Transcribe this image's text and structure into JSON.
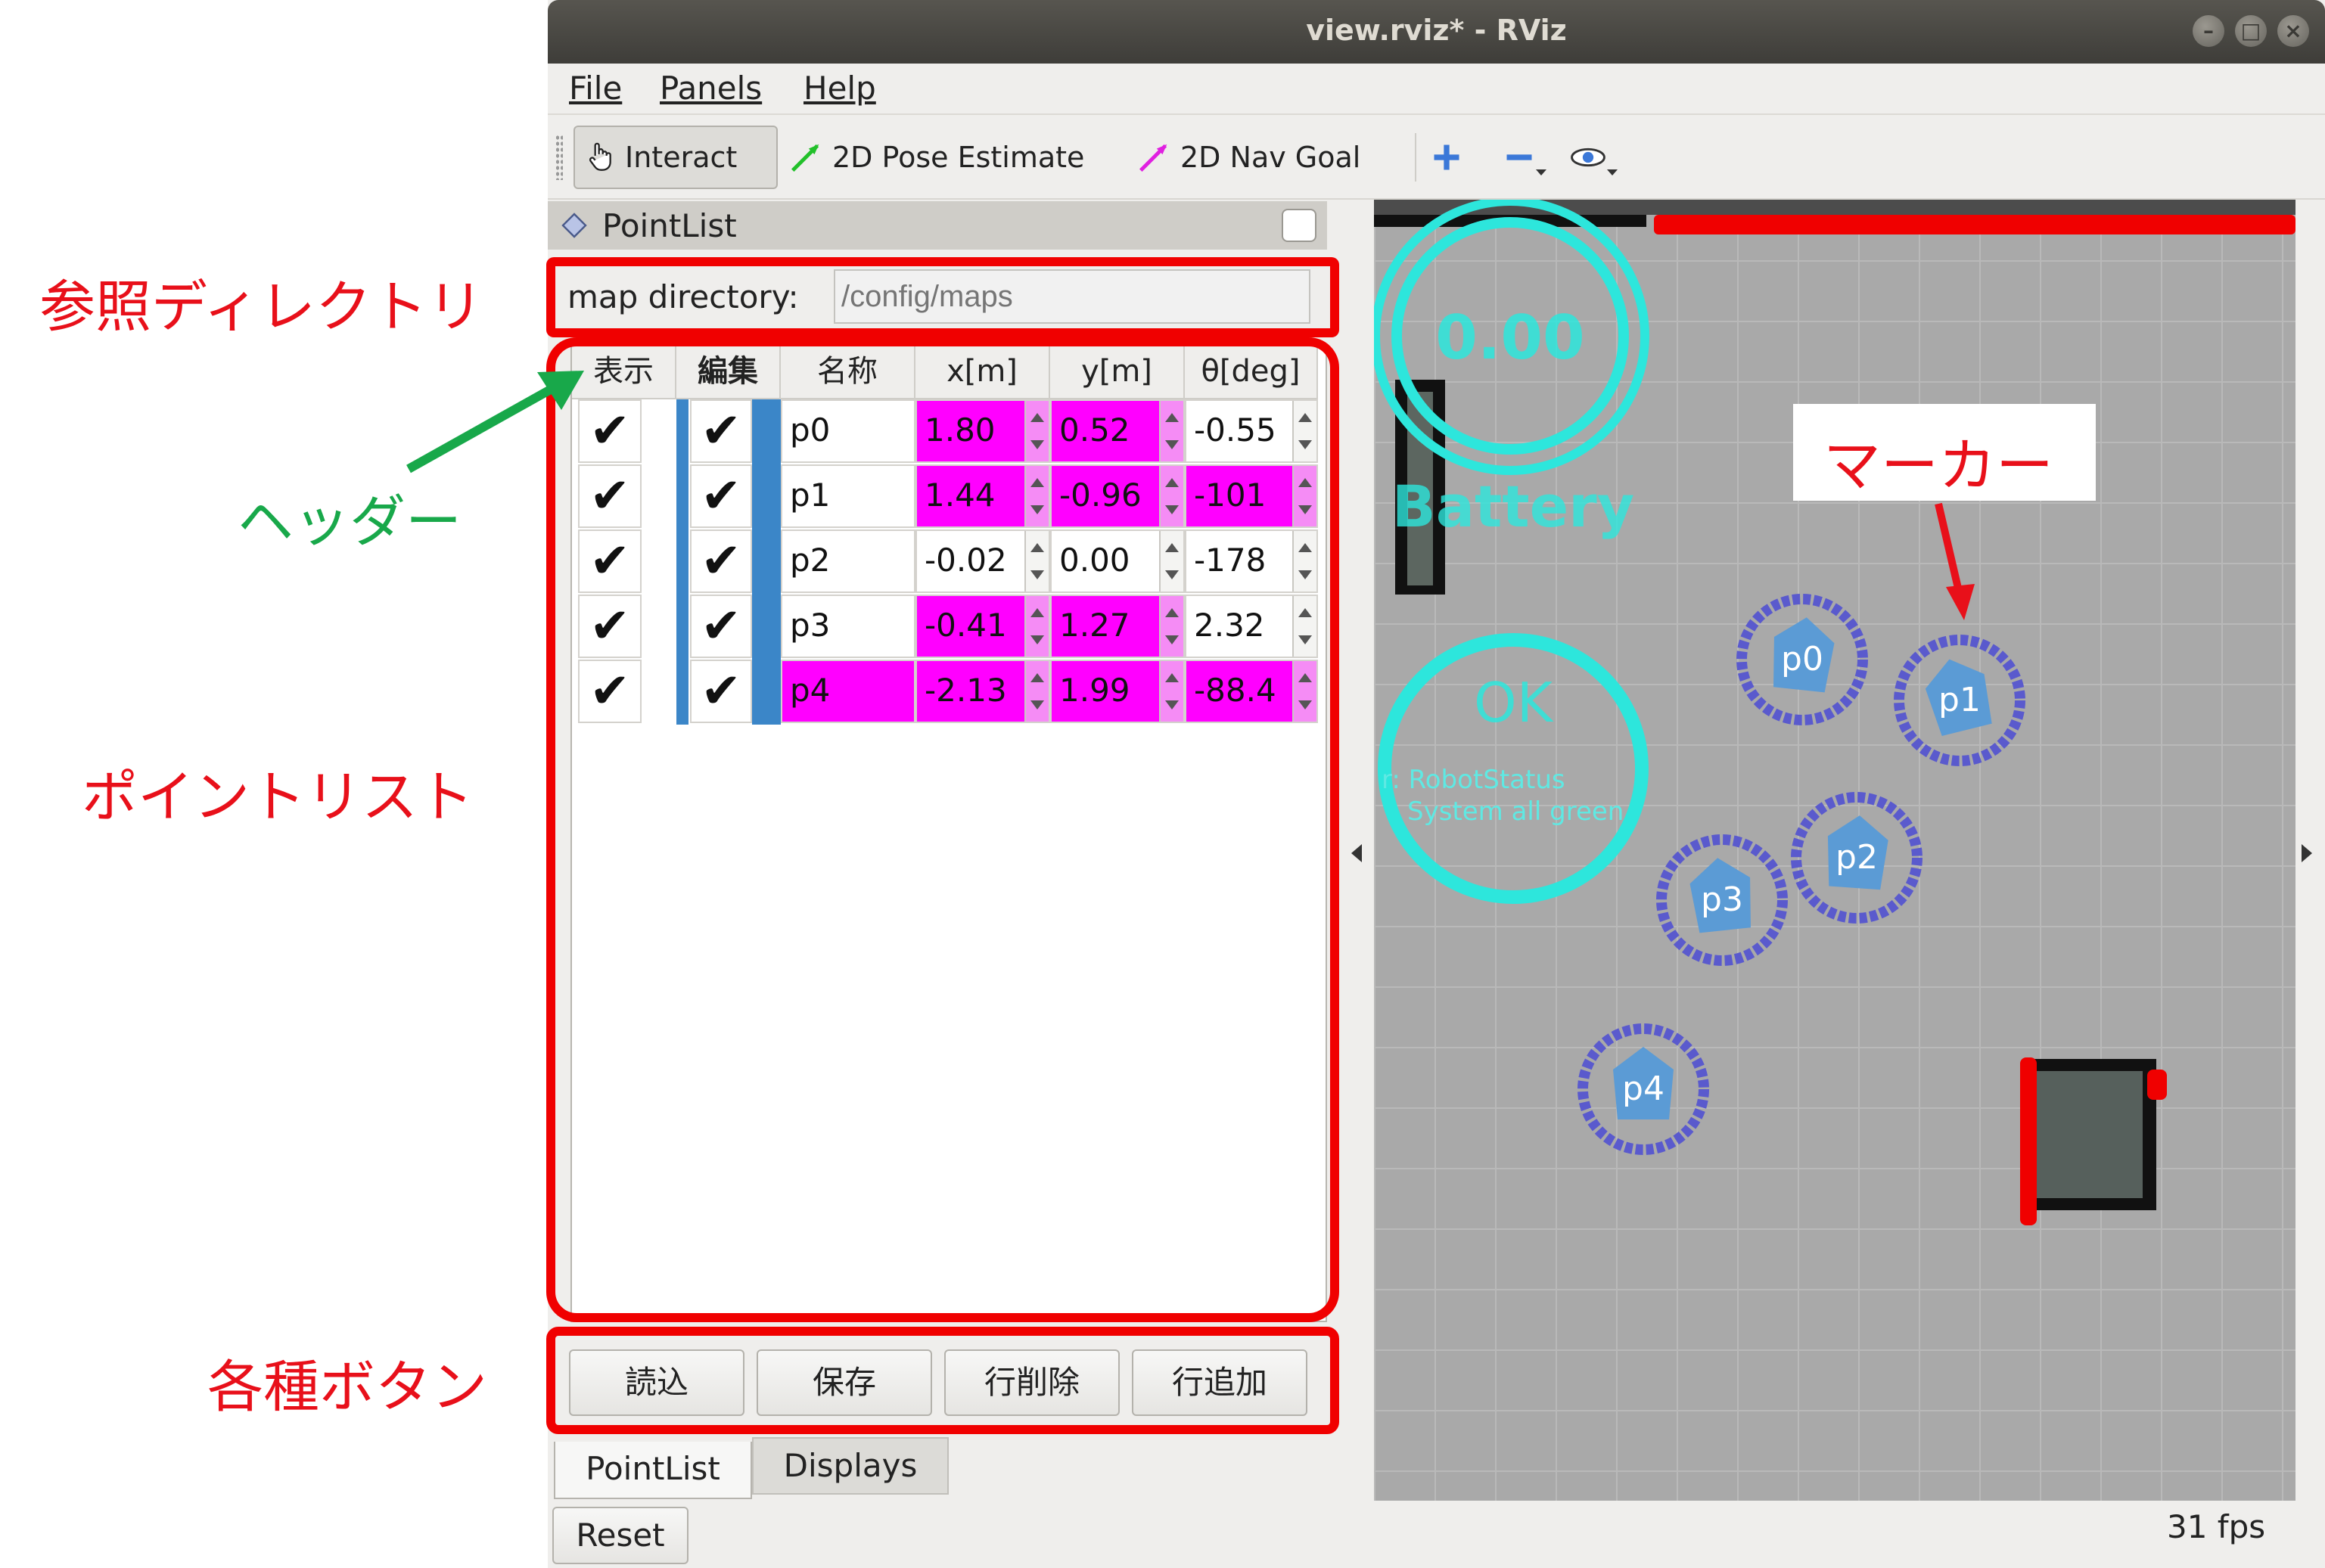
{
  "window": {
    "title": "view.rviz* - RViz",
    "buttons": [
      "–",
      "□",
      "×"
    ]
  },
  "menu": {
    "file": "File",
    "panels": "Panels",
    "help": "Help"
  },
  "toolbar": {
    "interact": "Interact",
    "pose_estimate": "2D Pose Estimate",
    "nav_goal": "2D Nav Goal"
  },
  "panel": {
    "title": "PointList",
    "map_directory_label": "map directory:",
    "map_directory_placeholder": "/config/maps"
  },
  "table": {
    "headers": [
      "表示",
      "編集",
      "名称",
      "x[m]",
      "y[m]",
      "θ[deg]"
    ],
    "rows": [
      {
        "show": "✔",
        "edit": "✔",
        "name": "p0",
        "x": "1.80",
        "y": "0.52",
        "theta": "-0.55",
        "hl": [
          false,
          true,
          true,
          false
        ]
      },
      {
        "show": "✔",
        "edit": "✔",
        "name": "p1",
        "x": "1.44",
        "y": "-0.96",
        "theta": "-101",
        "hl": [
          false,
          true,
          true,
          true
        ]
      },
      {
        "show": "✔",
        "edit": "✔",
        "name": "p2",
        "x": "-0.02",
        "y": "0.00",
        "theta": "-178",
        "hl": [
          false,
          false,
          false,
          false
        ]
      },
      {
        "show": "✔",
        "edit": "✔",
        "name": "p3",
        "x": "-0.41",
        "y": "1.27",
        "theta": "2.32",
        "hl": [
          false,
          true,
          true,
          false
        ]
      },
      {
        "show": "✔",
        "edit": "✔",
        "name": "p4",
        "x": "-2.13",
        "y": "1.99",
        "theta": "-88.4",
        "hl": [
          true,
          true,
          true,
          true
        ]
      }
    ]
  },
  "buttons": {
    "load": "読込",
    "save": "保存",
    "delete_row": "行削除",
    "add_row": "行追加"
  },
  "tabs": {
    "pointlist": "PointList",
    "displays": "Displays"
  },
  "reset_label": "Reset",
  "fps": "31 fps",
  "view": {
    "battery_value": "0.00",
    "battery_label": "Battery",
    "status_value": "OK",
    "status_line1": "r: RobotStatus",
    "status_line2": "System all green",
    "markers": [
      "p0",
      "p1",
      "p2",
      "p3",
      "p4"
    ]
  },
  "annotations": {
    "ref_dir": "参照ディレクトリ",
    "header": "ヘッダー",
    "pointlist": "ポイントリスト",
    "buttons": "各種ボタン",
    "marker": "マーカー"
  },
  "colors": {
    "highlight": "#ff00ff",
    "annotation_red": "#ff0000",
    "annotation_green": "#18a84a",
    "hud_cyan": "#2de6dc",
    "marker_ring": "#5a5acd",
    "marker_body": "#5b9bd5"
  }
}
